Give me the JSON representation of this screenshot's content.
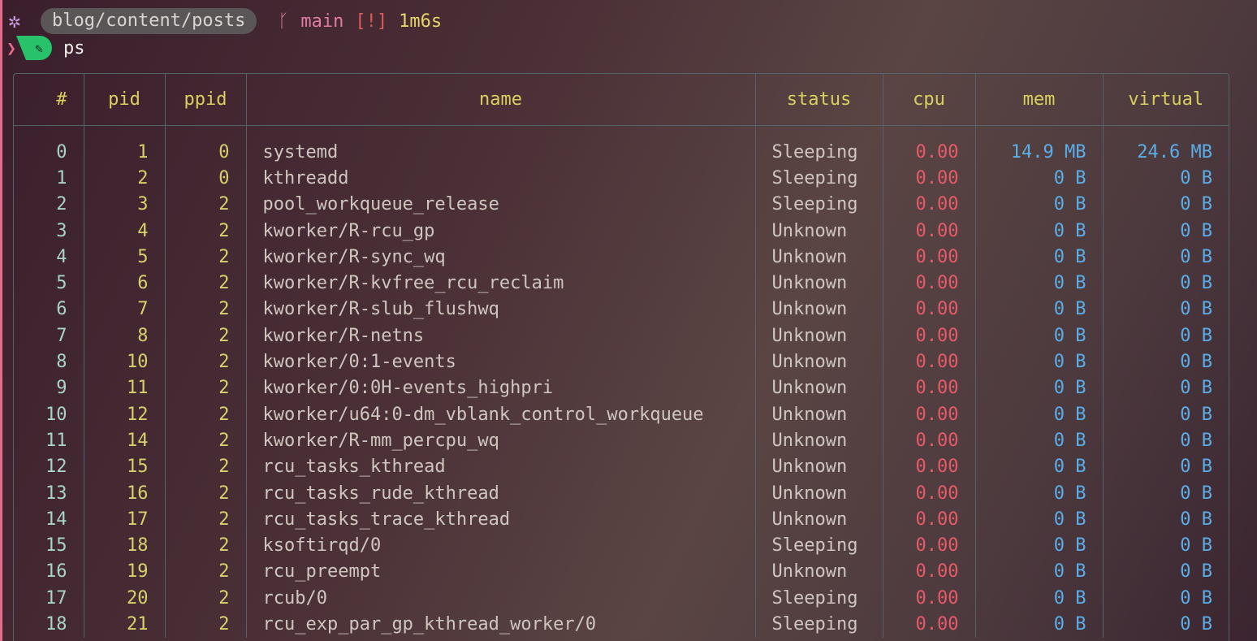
{
  "prompt": {
    "path": "blog/content/posts",
    "branch": "main",
    "status_flag": "[!]",
    "duration": "1m6s",
    "command": "ps"
  },
  "colors": {
    "accent_pink": "#e86a8a",
    "header_yellow": "#d9cf5f",
    "cpu_red": "#e85a6a",
    "mem_blue": "#5aaee8",
    "badge_green": "#27c26a"
  },
  "icons": {
    "gear": "gear-icon",
    "branch": "git-branch-icon",
    "edit": "pencil-icon"
  },
  "table": {
    "headers": [
      "#",
      "pid",
      "ppid",
      "name",
      "status",
      "cpu",
      "mem",
      "virtual"
    ],
    "rows": [
      [
        "0",
        "1",
        "0",
        "systemd",
        "Sleeping",
        "0.00",
        "14.9 MB",
        "24.6 MB"
      ],
      [
        "1",
        "2",
        "0",
        "kthreadd",
        "Sleeping",
        "0.00",
        "0 B",
        "0 B"
      ],
      [
        "2",
        "3",
        "2",
        "pool_workqueue_release",
        "Sleeping",
        "0.00",
        "0 B",
        "0 B"
      ],
      [
        "3",
        "4",
        "2",
        "kworker/R-rcu_gp",
        "Unknown",
        "0.00",
        "0 B",
        "0 B"
      ],
      [
        "4",
        "5",
        "2",
        "kworker/R-sync_wq",
        "Unknown",
        "0.00",
        "0 B",
        "0 B"
      ],
      [
        "5",
        "6",
        "2",
        "kworker/R-kvfree_rcu_reclaim",
        "Unknown",
        "0.00",
        "0 B",
        "0 B"
      ],
      [
        "6",
        "7",
        "2",
        "kworker/R-slub_flushwq",
        "Unknown",
        "0.00",
        "0 B",
        "0 B"
      ],
      [
        "7",
        "8",
        "2",
        "kworker/R-netns",
        "Unknown",
        "0.00",
        "0 B",
        "0 B"
      ],
      [
        "8",
        "10",
        "2",
        "kworker/0:1-events",
        "Unknown",
        "0.00",
        "0 B",
        "0 B"
      ],
      [
        "9",
        "11",
        "2",
        "kworker/0:0H-events_highpri",
        "Unknown",
        "0.00",
        "0 B",
        "0 B"
      ],
      [
        "10",
        "12",
        "2",
        "kworker/u64:0-dm_vblank_control_workqueue",
        "Unknown",
        "0.00",
        "0 B",
        "0 B"
      ],
      [
        "11",
        "14",
        "2",
        "kworker/R-mm_percpu_wq",
        "Unknown",
        "0.00",
        "0 B",
        "0 B"
      ],
      [
        "12",
        "15",
        "2",
        "rcu_tasks_kthread",
        "Unknown",
        "0.00",
        "0 B",
        "0 B"
      ],
      [
        "13",
        "16",
        "2",
        "rcu_tasks_rude_kthread",
        "Unknown",
        "0.00",
        "0 B",
        "0 B"
      ],
      [
        "14",
        "17",
        "2",
        "rcu_tasks_trace_kthread",
        "Unknown",
        "0.00",
        "0 B",
        "0 B"
      ],
      [
        "15",
        "18",
        "2",
        "ksoftirqd/0",
        "Sleeping",
        "0.00",
        "0 B",
        "0 B"
      ],
      [
        "16",
        "19",
        "2",
        "rcu_preempt",
        "Unknown",
        "0.00",
        "0 B",
        "0 B"
      ],
      [
        "17",
        "20",
        "2",
        "rcub/0",
        "Sleeping",
        "0.00",
        "0 B",
        "0 B"
      ],
      [
        "18",
        "21",
        "2",
        "rcu_exp_par_gp_kthread_worker/0",
        "Sleeping",
        "0.00",
        "0 B",
        "0 B"
      ]
    ]
  }
}
